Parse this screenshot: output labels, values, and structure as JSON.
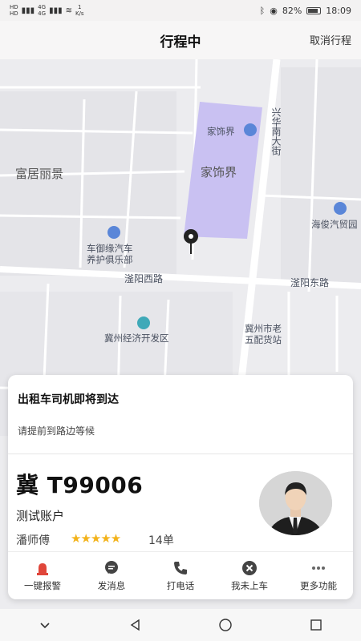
{
  "status_bar": {
    "network_hd1": "HD",
    "network_hd2": "HD",
    "sig1": "4G",
    "sig2": "4G",
    "speed": "1",
    "speed_unit": "K/s",
    "battery": "82%",
    "battery_level": 0.82,
    "time": "18:09"
  },
  "header": {
    "title": "行程中",
    "cancel": "取消行程"
  },
  "map": {
    "labels": {
      "fujuliying": "富居丽景",
      "jiashijie_poi": "家饰界",
      "jiashijie_area": "家饰界",
      "xinghua_road": "兴华南大街",
      "haijun": "海俊汽贸园",
      "cheyuyuan_1": "车御缘汽车",
      "cheyuyuan_2": "养护俱乐部",
      "fuyang_west": "滏阳西路",
      "fuyang_east": "滏阳东路",
      "jizhou_dev": "冀州经济开发区",
      "jizhou_old_1": "冀州市老",
      "jizhou_old_2": "五配货站"
    }
  },
  "card": {
    "notice_title": "出租车司机即将到达",
    "notice_sub": "请提前到路边等候",
    "plate": "冀 T99006",
    "account": "测试账户",
    "driver": "潘师傅",
    "rating": 5,
    "stars": "★★★★★",
    "orders": "14单"
  },
  "actions": [
    {
      "label": "一键报警",
      "icon": "alarm-icon"
    },
    {
      "label": "发消息",
      "icon": "message-icon"
    },
    {
      "label": "打电话",
      "icon": "phone-icon"
    },
    {
      "label": "我未上车",
      "icon": "close-circle-icon"
    },
    {
      "label": "更多功能",
      "icon": "more-icon"
    }
  ],
  "colors": {
    "alarm": "#e0463a",
    "highlight_area": "#c9c1f2",
    "star": "#f3b31b"
  }
}
